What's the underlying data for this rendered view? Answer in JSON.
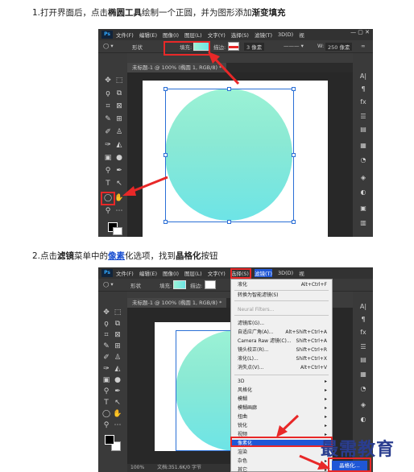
{
  "step1": {
    "prefix": "1.打开界面后，点击",
    "bold1": "椭圆工具",
    "mid": "绘制一个正圆，并为图形添加",
    "bold2": "渐变填充"
  },
  "step2": {
    "prefix": "2.点击",
    "bold1": "滤镜",
    "mid1": "菜单中的",
    "link": "像素",
    "mid2": "化选项，找到",
    "bold2": "晶格化",
    "suffix": "按钮"
  },
  "menubar1": [
    "文件(F)",
    "编辑(E)",
    "图像(I)",
    "图层(L)",
    "文字(Y)",
    "选择(S)",
    "滤镜(T)",
    "3D(D)",
    "视"
  ],
  "menubar2": [
    "文件(F)",
    "编辑(E)",
    "图像(I)",
    "图层(L)",
    "文字(Y)",
    "选择(S)",
    "滤镜(T)",
    "3D(D)",
    "视"
  ],
  "ps_logo": "Ps",
  "options1": {
    "shape_mode": "形状",
    "fill_label": "填充:",
    "stroke_label": "描边:",
    "stroke_width": "3 像素",
    "w_label": "W:",
    "w_value": "250 像素"
  },
  "options2": {
    "shape_mode": "形状",
    "fill_label": "填充:",
    "stroke_label": "描边:"
  },
  "doc_tab1": "未标题-1 @ 100% (椭圆 1, RGB/8) *",
  "doc_tab2": "未标题-1 @ 100% (椭圆 1, RGB/8) *",
  "status_zoom": "100%",
  "status_doc": "文档:351.6K/0 字节",
  "filter_menu": {
    "items": [
      {
        "label": "液化",
        "shortcut": "Alt+Ctrl+F",
        "dim": false
      },
      {
        "label": "转换为智能滤镜(S)",
        "shortcut": "",
        "dim": false
      },
      {
        "label": "Neural Filters...",
        "shortcut": "",
        "dim": true
      },
      {
        "label": "滤镜库(G)...",
        "shortcut": "",
        "dim": false
      },
      {
        "label": "自适应广角(A)...",
        "shortcut": "Alt+Shift+Ctrl+A",
        "dim": false
      },
      {
        "label": "Camera Raw 滤镜(C)...",
        "shortcut": "Shift+Ctrl+A",
        "dim": false
      },
      {
        "label": "镜头校正(R)...",
        "shortcut": "Shift+Ctrl+R",
        "dim": false
      },
      {
        "label": "液化(L)...",
        "shortcut": "Shift+Ctrl+X",
        "dim": false
      },
      {
        "label": "消失点(V)...",
        "shortcut": "Alt+Ctrl+V",
        "dim": false
      },
      {
        "label": "3D",
        "shortcut": "",
        "dim": false
      },
      {
        "label": "风格化",
        "shortcut": "",
        "dim": false
      },
      {
        "label": "模糊",
        "shortcut": "",
        "dim": false
      },
      {
        "label": "模糊画廊",
        "shortcut": "",
        "dim": false
      },
      {
        "label": "扭曲",
        "shortcut": "",
        "dim": false
      },
      {
        "label": "锐化",
        "shortcut": "",
        "dim": false
      },
      {
        "label": "视频",
        "shortcut": "",
        "dim": false
      },
      {
        "label": "像素化",
        "shortcut": "",
        "dim": false
      },
      {
        "label": "渲染",
        "shortcut": "",
        "dim": false
      },
      {
        "label": "杂色",
        "shortcut": "",
        "dim": false
      },
      {
        "label": "其它",
        "shortcut": "",
        "dim": false
      }
    ]
  },
  "submenu_item": "晶格化...",
  "watermark": "最需教育",
  "colors": {
    "ps_bg": "#3c3c3c",
    "highlight": "#1f57d6",
    "annotation_red": "#e82828",
    "gradient_top": "#9bf2d5",
    "gradient_bottom": "#6de4e6"
  },
  "icons": [
    "move-icon",
    "marquee-icon",
    "lasso-icon",
    "quick-select-icon",
    "crop-icon",
    "frame-icon",
    "eyedropper-icon",
    "spot-heal-icon",
    "brush-icon",
    "stamp-icon",
    "history-brush-icon",
    "eraser-icon",
    "gradient-icon",
    "blur-icon",
    "dodge-icon",
    "pen-icon",
    "type-icon",
    "path-select-icon",
    "ellipse-tool-icon",
    "hand-icon",
    "zoom-icon",
    "more-icon"
  ]
}
